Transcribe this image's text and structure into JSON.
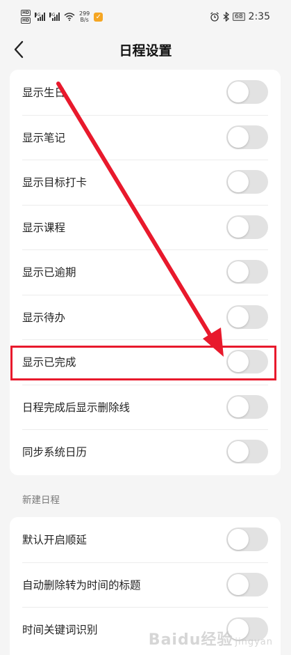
{
  "status_bar": {
    "hd1": "HD",
    "hd2": "HD",
    "sig1": "4G",
    "sig2": "4G",
    "speed_value": "299",
    "speed_unit": "B/s",
    "app_badge": "✓",
    "battery": "68",
    "time": "2:35"
  },
  "header": {
    "title": "日程设置"
  },
  "settings": [
    {
      "label": "显示生日",
      "on": false
    },
    {
      "label": "显示笔记",
      "on": false
    },
    {
      "label": "显示目标打卡",
      "on": false
    },
    {
      "label": "显示课程",
      "on": false
    },
    {
      "label": "显示已逾期",
      "on": false
    },
    {
      "label": "显示待办",
      "on": false
    },
    {
      "label": "显示已完成",
      "on": false
    },
    {
      "label": "日程完成后显示删除线",
      "on": false
    },
    {
      "label": "同步系统日历",
      "on": false
    }
  ],
  "new_schedule": {
    "section_title": "新建日程",
    "items": [
      {
        "label": "默认开启顺延",
        "on": false
      },
      {
        "label": "自动删除转为时间的标题",
        "on": false
      },
      {
        "label": "时间关键词识别",
        "on": false
      }
    ]
  },
  "watermark": {
    "text": "Baidu经验",
    "sub": "jingyan"
  },
  "colors": {
    "annotation_red": "#e8192c",
    "toggle_off": "#e2e2e2",
    "background": "#f5f5f5"
  }
}
